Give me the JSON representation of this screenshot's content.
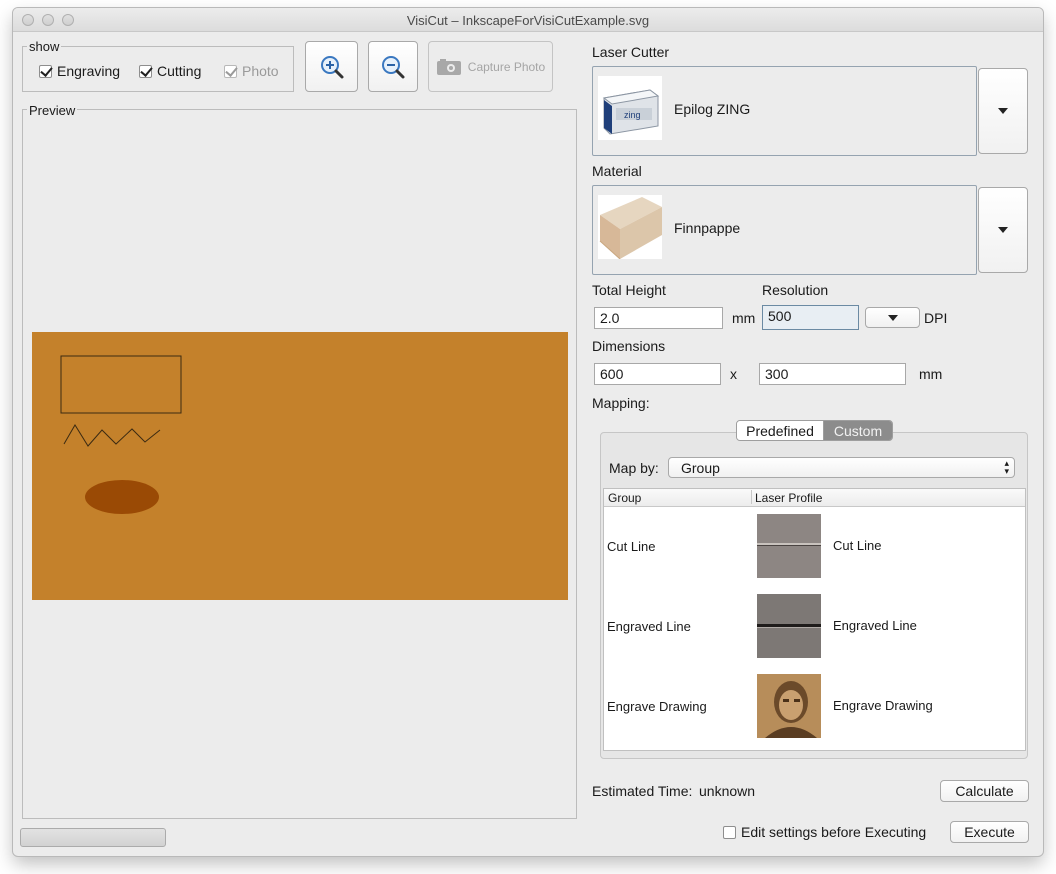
{
  "window": {
    "title": "VisiCut – InkscapeForVisiCutExample.svg"
  },
  "show": {
    "legend": "show",
    "engraving": {
      "label": "Engraving",
      "checked": true
    },
    "cutting": {
      "label": "Cutting",
      "checked": true
    },
    "photo": {
      "label": "Photo",
      "checked": true,
      "enabled": false
    }
  },
  "toolbar": {
    "zoom_in_icon": "zoom-in-icon",
    "zoom_out_icon": "zoom-out-icon",
    "capture_label": "Capture Photo",
    "capture_icon": "camera-icon"
  },
  "preview": {
    "legend": "Preview",
    "board_color": "#c4812b",
    "ellipse_color": "#9a4a05",
    "stroke_color": "#3b2a12"
  },
  "laser_cutter": {
    "label": "Laser Cutter",
    "name": "Epilog ZING"
  },
  "material": {
    "label": "Material",
    "name": "Finnpappe"
  },
  "total_height": {
    "label": "Total Height",
    "value": "2.0",
    "unit": "mm"
  },
  "resolution": {
    "label": "Resolution",
    "value": "500",
    "unit": "DPI"
  },
  "dimensions": {
    "label": "Dimensions",
    "width": "600",
    "separator": "x",
    "height": "300",
    "unit": "mm"
  },
  "mapping": {
    "label": "Mapping:",
    "tabs": {
      "predefined": "Predefined",
      "custom": "Custom"
    },
    "map_by_label": "Map by:",
    "map_by_value": "Group",
    "columns": {
      "group": "Group",
      "profile": "Laser Profile"
    },
    "rows": [
      {
        "group": "Cut Line",
        "profile": "Cut Line"
      },
      {
        "group": "Engraved Line",
        "profile": "Engraved Line"
      },
      {
        "group": "Engrave Drawing",
        "profile": "Engrave Drawing"
      }
    ]
  },
  "estimated": {
    "label": "Estimated Time:",
    "value": "unknown"
  },
  "buttons": {
    "calculate": "Calculate",
    "execute": "Execute"
  },
  "edit_before": {
    "label": "Edit settings before Executing",
    "checked": false
  }
}
